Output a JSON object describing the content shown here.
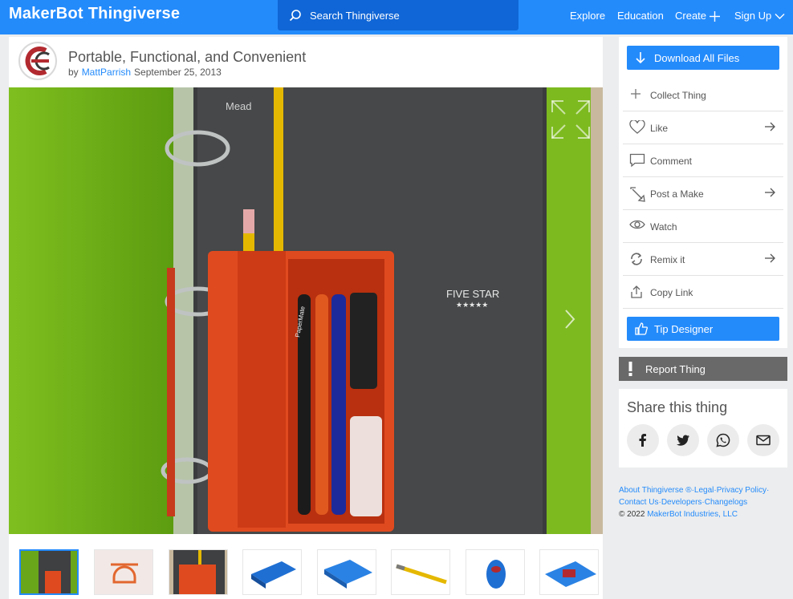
{
  "header": {
    "logo_brand": "MakerBot",
    "logo_product": "Thingiverse",
    "search_placeholder": "Search Thingiverse",
    "nav": [
      "Explore",
      "Education",
      "Create",
      "Sign Up"
    ]
  },
  "thing": {
    "title": "Portable, Functional, and Convenient",
    "by": "by",
    "author": "MattParrish",
    "date": "September 25, 2013"
  },
  "photo": {
    "cover_brand": "Mead",
    "cover_label": "FIVE STAR",
    "cover_stars": "★★★★★",
    "pencil_brand": "PaperMate"
  },
  "sidebar": {
    "download": "Download All Files",
    "actions": [
      {
        "label": "Collect Thing",
        "icon": "plus-icon",
        "arrow": false
      },
      {
        "label": "Like",
        "icon": "heart-icon",
        "arrow": true
      },
      {
        "label": "Comment",
        "icon": "comment-icon",
        "arrow": false
      },
      {
        "label": "Post a Make",
        "icon": "make-icon",
        "arrow": true
      },
      {
        "label": "Watch",
        "icon": "eye-icon",
        "arrow": false
      },
      {
        "label": "Remix it",
        "icon": "remix-icon",
        "arrow": true
      },
      {
        "label": "Copy Link",
        "icon": "share-icon",
        "arrow": false
      }
    ],
    "tip": "Tip Designer",
    "report": "Report Thing"
  },
  "share": {
    "title": "Share this thing",
    "icons": [
      "facebook-icon",
      "twitter-icon",
      "whatsapp-icon",
      "email-icon"
    ]
  },
  "footer": {
    "about": "About Thingiverse",
    "reg": "®",
    "sep": "·",
    "legal": "Legal",
    "privacy": "Privacy Policy",
    "contact": "Contact Us",
    "developers": "Developers",
    "changelogs": "Changelogs",
    "copy": "©  2022",
    "company": "MakerBot Industries, LLC"
  },
  "colors": {
    "accent": "#248bfb",
    "search_bg": "#1066d6",
    "report_bg": "#696969"
  }
}
